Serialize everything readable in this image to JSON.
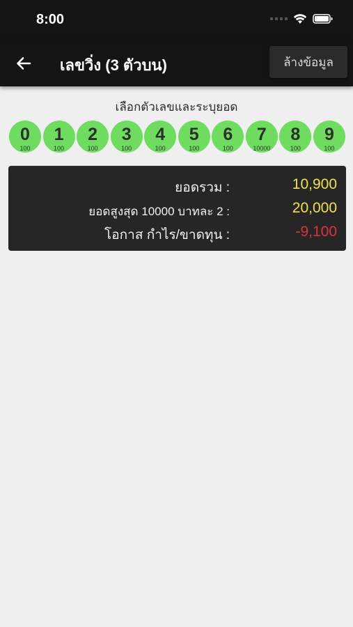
{
  "status_bar": {
    "time": "8:00"
  },
  "app_bar": {
    "title": "เลขวิ่ง (3 ตัวบน)",
    "clear_label": "ล้างข้อมูล"
  },
  "instruction": "เลือกตัวเลขและระบุยอด",
  "digits": [
    {
      "num": "0",
      "amount": "100"
    },
    {
      "num": "1",
      "amount": "100"
    },
    {
      "num": "2",
      "amount": "100"
    },
    {
      "num": "3",
      "amount": "100"
    },
    {
      "num": "4",
      "amount": "100"
    },
    {
      "num": "5",
      "amount": "100"
    },
    {
      "num": "6",
      "amount": "100"
    },
    {
      "num": "7",
      "amount": "10000"
    },
    {
      "num": "8",
      "amount": "100"
    },
    {
      "num": "9",
      "amount": "100"
    }
  ],
  "summary": {
    "total": {
      "label": "ยอดรวม :",
      "value": "10,900"
    },
    "max": {
      "label": "ยอดสูงสุด 10000 บาทละ 2 :",
      "value": "20,000"
    },
    "profit": {
      "label": "โอกาส กำไร/ขาดทุน :",
      "value": "-9,100"
    }
  },
  "colors": {
    "digit_bg": "#6edc5f",
    "value_yellow": "#f1e24a",
    "value_red": "#e0313f",
    "bar_bg": "#141414"
  }
}
